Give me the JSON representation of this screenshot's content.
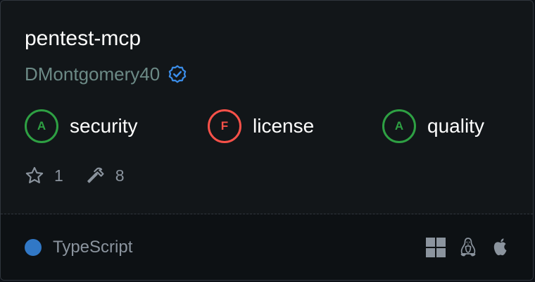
{
  "server": {
    "name": "pentest-mcp",
    "author": "DMontgomery40",
    "verified_icon": "verified-badge-icon"
  },
  "grades": [
    {
      "letter": "A",
      "label": "security",
      "color": "#2ea043"
    },
    {
      "letter": "F",
      "label": "license",
      "color": "#f85149"
    },
    {
      "letter": "A",
      "label": "quality",
      "color": "#2ea043"
    }
  ],
  "stats": {
    "stars": "1",
    "star_icon": "star-icon",
    "tools": "8",
    "tools_icon": "hammer-icon"
  },
  "footer": {
    "language": "TypeScript",
    "language_color": "#3178c6",
    "platforms": [
      "windows-icon",
      "linux-icon",
      "apple-icon"
    ]
  }
}
